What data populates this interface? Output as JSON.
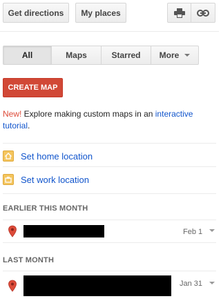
{
  "toolbar": {
    "directions_label": "Get directions",
    "myplaces_label": "My places",
    "print_icon": "printer-icon",
    "link_icon": "link-icon"
  },
  "tabs": [
    {
      "label": "All",
      "active": true
    },
    {
      "label": "Maps",
      "active": false
    },
    {
      "label": "Starred",
      "active": false
    },
    {
      "label": "More",
      "active": false
    }
  ],
  "create_map_label": "CREATE MAP",
  "promo": {
    "new_label": "New!",
    "text": " Explore making custom maps in an ",
    "link_label": "interactive tutorial",
    "end": "."
  },
  "locations": {
    "home_label": "Set home location",
    "work_label": "Set work location",
    "home_icon": "home-icon",
    "work_icon": "briefcase-icon"
  },
  "sections": {
    "earlier_label": "EARLIER THIS MONTH",
    "last_label": "LAST MONTH"
  },
  "places": [
    {
      "date": "Feb 1",
      "icon": "map-pin-icon"
    },
    {
      "date": "Jan 31",
      "icon": "map-pin-icon"
    }
  ],
  "colors": {
    "accent_red": "#d14836",
    "link_blue": "#1155cc",
    "new_red": "#dd4b39",
    "pin_red": "#dd4b39"
  }
}
